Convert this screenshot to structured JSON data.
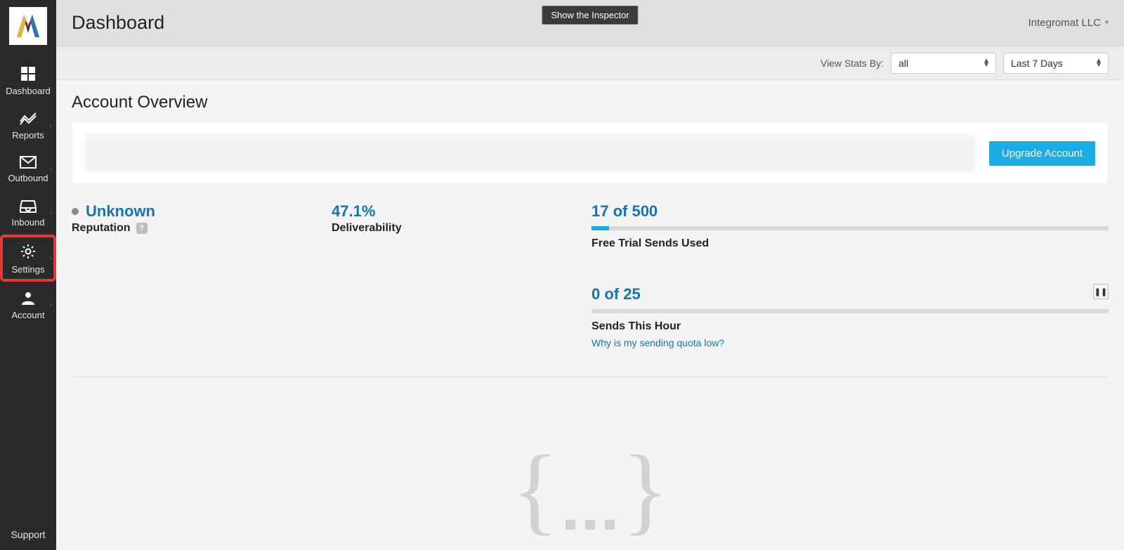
{
  "sidebar": {
    "items": [
      {
        "label": "Dashboard",
        "icon": "grid-icon",
        "chevron": false
      },
      {
        "label": "Reports",
        "icon": "chart-icon",
        "chevron": true
      },
      {
        "label": "Outbound",
        "icon": "envelope-icon",
        "chevron": true
      },
      {
        "label": "Inbound",
        "icon": "inbox-icon",
        "chevron": true
      },
      {
        "label": "Settings",
        "icon": "gear-icon",
        "chevron": true,
        "highlighted": true
      },
      {
        "label": "Account",
        "icon": "user-icon",
        "chevron": true
      }
    ],
    "support_label": "Support"
  },
  "topbar": {
    "title": "Dashboard",
    "inspector_label": "Show the Inspector",
    "org_name": "Integromat LLC"
  },
  "filterbar": {
    "label": "View Stats By:",
    "select_view": "all",
    "select_range": "Last 7 Days"
  },
  "overview": {
    "heading": "Account Overview",
    "upgrade_button": "Upgrade Account",
    "reputation": {
      "value": "Unknown",
      "label": "Reputation"
    },
    "deliverability": {
      "value": "47.1%",
      "label": "Deliverability"
    },
    "trial_sends": {
      "value": "17 of 500",
      "label": "Free Trial Sends Used",
      "used": 17,
      "total": 500,
      "fill_percent": 3.4
    },
    "hour_sends": {
      "value": "0 of 25",
      "label": "Sends This Hour",
      "note": "Why is my sending quota low?",
      "used": 0,
      "total": 25,
      "fill_percent": 0
    }
  }
}
